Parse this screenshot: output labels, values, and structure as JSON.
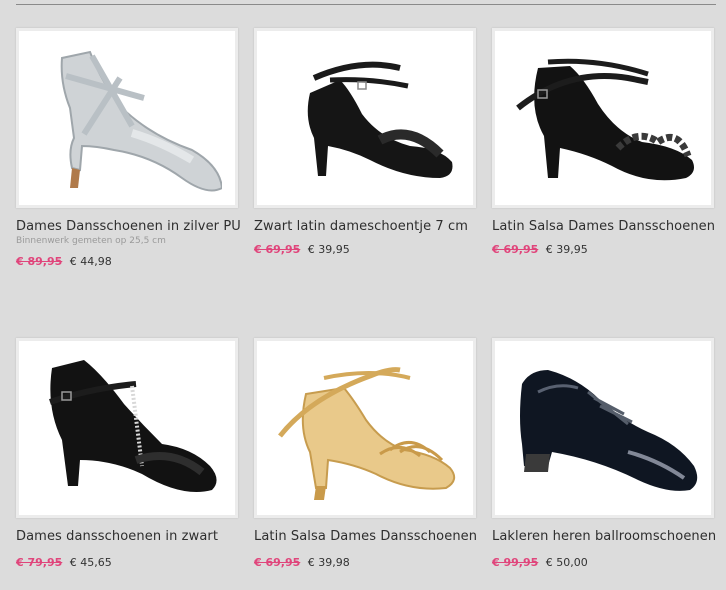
{
  "colors": {
    "background": "#dcdcdc",
    "sale_price": "#e0457b",
    "title_text": "#2e2e2e",
    "muted_text": "#9a9a9a"
  },
  "products": [
    {
      "name": "Dames Dansschoenen in zilver PU",
      "note": "Binnenwerk gemeten op 25,5 cm",
      "old_price": "€ 89,95",
      "price": "€ 44,98",
      "image_icon": "silver-dance-shoe-icon"
    },
    {
      "name": "Zwart latin dameschoentje 7 cm",
      "old_price": "€ 69,95",
      "price": "€ 39,95",
      "image_icon": "black-latin-sandal-icon"
    },
    {
      "name": "Latin Salsa Dames Dansschoenen",
      "old_price": "€ 69,95",
      "price": "€ 39,95",
      "image_icon": "black-braided-sandal-icon"
    },
    {
      "name": "Dames dansschoenen in zwart",
      "old_price": "€ 79,95",
      "price": "€ 45,65",
      "image_icon": "black-t-strap-shoe-icon"
    },
    {
      "name": "Latin Salsa Dames Dansschoenen",
      "old_price": "€ 69,95",
      "price": "€ 39,98",
      "image_icon": "gold-latin-sandal-icon"
    },
    {
      "name": "Lakleren heren ballroomschoenen",
      "old_price": "€ 99,95",
      "price": "€ 50,00",
      "image_icon": "patent-mens-ballroom-shoe-icon"
    }
  ]
}
